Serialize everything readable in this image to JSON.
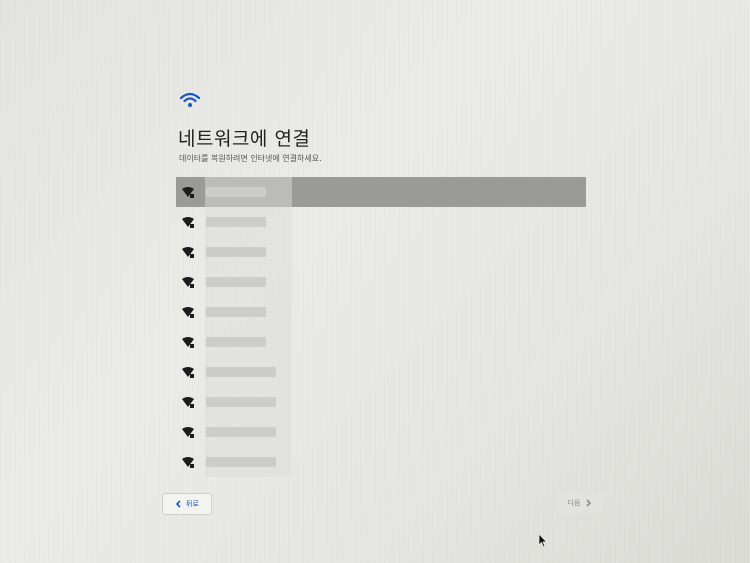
{
  "header": {
    "icon": "wifi-icon",
    "accent_color": "#1a57c8",
    "title": "네트워크에 연결",
    "subtitle": "데이터를 복원하려면 인터넷에 연결하세요."
  },
  "networks": [
    {
      "name": "",
      "selected": true
    },
    {
      "name": "",
      "selected": false
    },
    {
      "name": "",
      "selected": false
    },
    {
      "name": "",
      "selected": false
    },
    {
      "name": "",
      "selected": false
    },
    {
      "name": "",
      "selected": false
    },
    {
      "name": "",
      "selected": false
    },
    {
      "name": "",
      "selected": false
    },
    {
      "name": "",
      "selected": false
    },
    {
      "name": "",
      "selected": false
    }
  ],
  "footer": {
    "back_label": "뒤로",
    "next_label": "다음"
  }
}
